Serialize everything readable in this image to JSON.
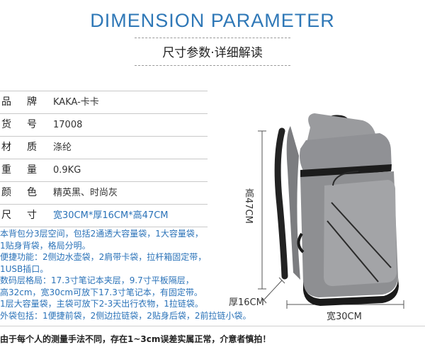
{
  "header": {
    "title_en": "DIMENSION PARAMETER",
    "title_cn": "尺寸参数·详细解读"
  },
  "specs": [
    {
      "label": "品牌",
      "value": "KAKA-卡卡"
    },
    {
      "label": "货号",
      "value": "17008"
    },
    {
      "label": "材质",
      "value": "涤纶"
    },
    {
      "label": "重量",
      "value": "0.9KG"
    },
    {
      "label": "颜色",
      "value": "精英黑、时尚灰"
    },
    {
      "label": "尺寸",
      "value": "宽30CM*厚16CM*高47CM"
    }
  ],
  "description": [
    "本背包分3层空间，包括2通透大容量袋，1大容量袋，",
    "1贴身背袋，格局分明。",
    "便捷功能：2侧边水壶袋，2肩带卡袋，拉杆箱固定带，",
    "1USB插口。",
    "数码层格局：17.3寸笔记本夹层，9.7寸平板隔层，",
    "高32cm，宽30cm可放下17.3寸笔记本，有固定带。",
    "1层大容量袋，主袋可放下2-3天出行衣物，1拉链袋。",
    "外袋包括：1便捷前袋，2侧边拉链袋，2贴身后袋，2前拉链小袋。"
  ],
  "footer_note": "由于每个人的测量手法不同，存在1~3cm误差实属正常，介意者慎拍！",
  "dimensions": {
    "height": "高47CM",
    "depth": "厚16CM",
    "width": "宽30CM"
  },
  "colors": {
    "title": "#2f78b7",
    "accent_text": "#2a72b8",
    "bag_body": "#8e8f92"
  }
}
